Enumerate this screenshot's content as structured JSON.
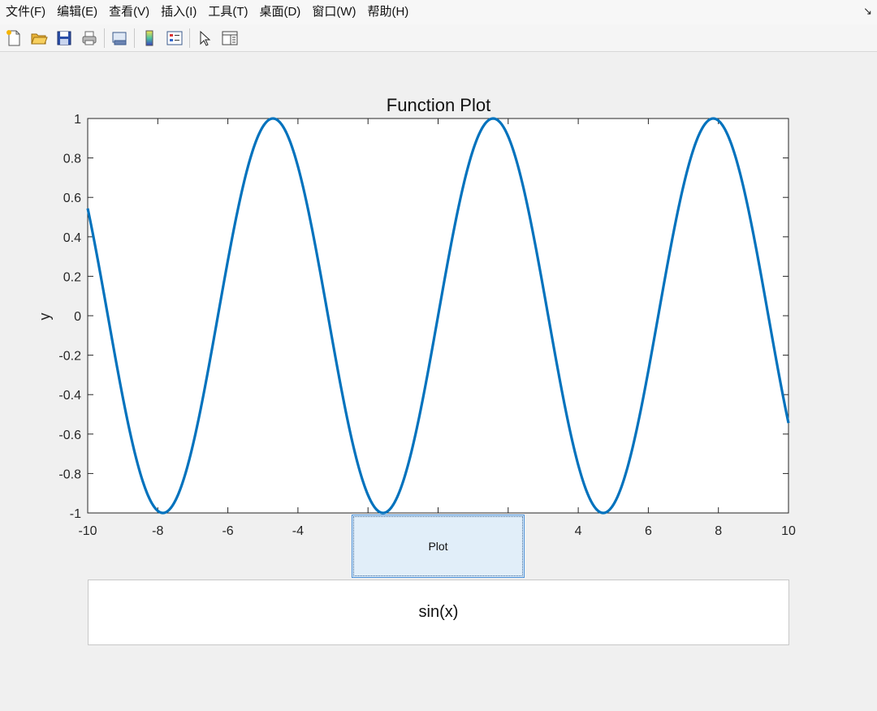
{
  "menu": {
    "items": [
      "文件(F)",
      "编辑(E)",
      "查看(V)",
      "插入(I)",
      "工具(T)",
      "桌面(D)",
      "窗口(W)",
      "帮助(H)"
    ]
  },
  "toolbar": {
    "icons": [
      "new-figure-icon",
      "open-file-icon",
      "save-icon",
      "print-icon",
      "link-plot-icon",
      "colorbar-icon",
      "legend-icon",
      "pointer-icon",
      "property-editor-icon"
    ]
  },
  "chart_data": {
    "type": "line",
    "title": "Function Plot",
    "xlabel": "",
    "ylabel": "y",
    "xlim": [
      -10,
      10
    ],
    "ylim": [
      -1,
      1
    ],
    "xticks": [
      -10,
      -8,
      -6,
      -4,
      4,
      6,
      8,
      10
    ],
    "yticks": [
      1,
      0.8,
      0.6,
      0.4,
      0.2,
      0,
      -0.2,
      -0.4,
      -0.6,
      -0.8,
      -1
    ],
    "series": [
      {
        "function": "sin(x)",
        "color": "#0072bd"
      }
    ],
    "grid": false
  },
  "controls": {
    "plot_button_label": "Plot",
    "function_input_value": "sin(x)"
  }
}
